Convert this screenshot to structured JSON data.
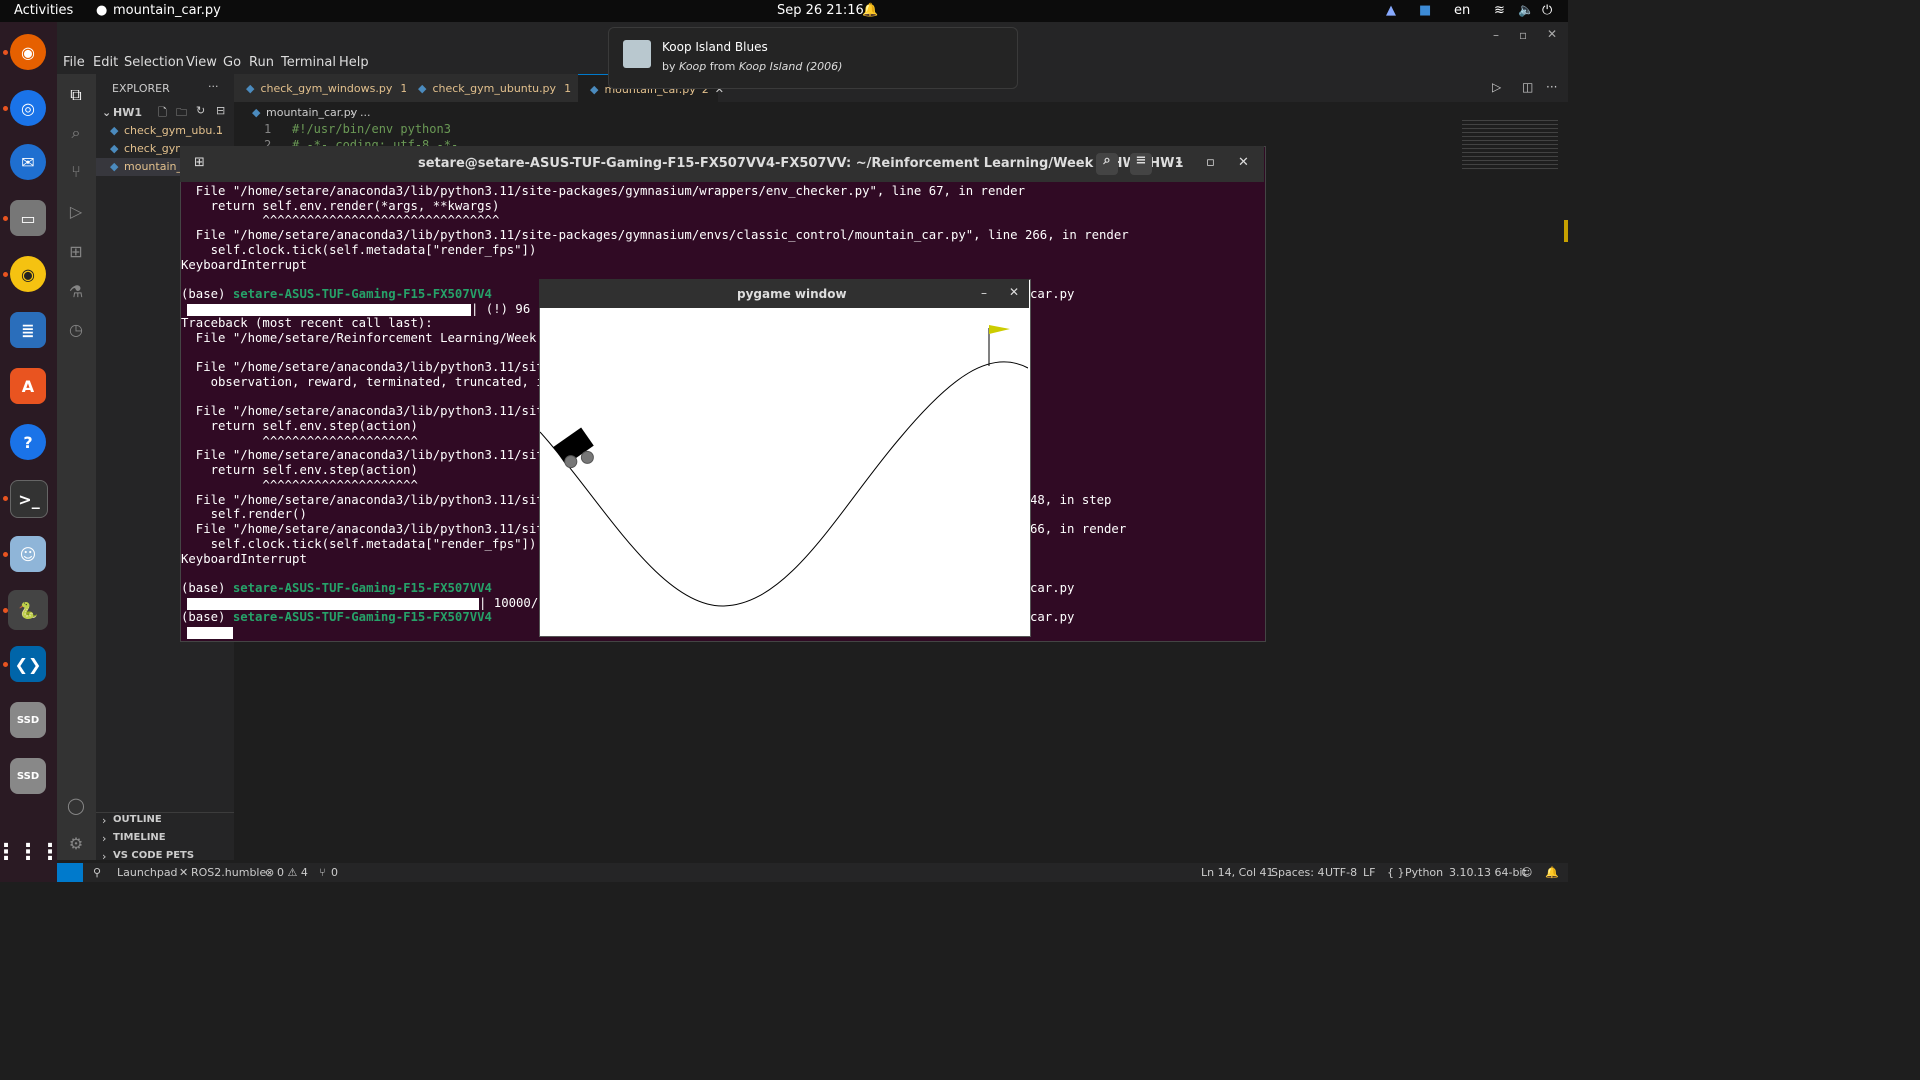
{
  "topbar": {
    "activities": "Activities",
    "app_name": "mountain_car.py",
    "clock": "Sep 26  21:16",
    "lang": "en"
  },
  "notification": {
    "title": "Koop Island Blues",
    "by": "by",
    "artist": "Koop",
    "from": "from",
    "album": "Koop Island (2006)"
  },
  "menu": [
    "File",
    "Edit",
    "Selection",
    "View",
    "Go",
    "Run",
    "Terminal",
    "Help"
  ],
  "explorer": {
    "header": "EXPLORER",
    "folder": "HW1",
    "files": [
      {
        "name": "check_gym_ubu...",
        "badge": "1"
      },
      {
        "name": "check_gym_",
        "badge": ""
      },
      {
        "name": "mountain_c",
        "badge": ""
      }
    ],
    "sections": [
      "OUTLINE",
      "TIMELINE",
      "VS CODE PETS"
    ]
  },
  "tabs": [
    {
      "label": "check_gym_windows.py",
      "badge": "1"
    },
    {
      "label": "check_gym_ubuntu.py",
      "badge": "1"
    },
    {
      "label": "mountain_car.py",
      "badge": "2"
    }
  ],
  "breadcrumb": {
    "file": "mountain_car.py",
    "rest": "..."
  },
  "editor": {
    "line1_no": "1",
    "line1": "#!/usr/bin/env python3",
    "line2_no": "2",
    "line2": "# -*- coding: utf-8 -*-"
  },
  "terminal": {
    "title": "setare@setare-ASUS-TUF-Gaming-F15-FX507VV4-FX507VV: ~/Reinforcement Learning/Week 1/HWs/HW1",
    "lines": [
      "  File \"/home/setare/anaconda3/lib/python3.11/site-packages/gymnasium/wrappers/env_checker.py\", line 67, in render",
      "    return self.env.render(*args, **kwargs)",
      "           ^^^^^^^^^^^^^^^^^^^^^^^^^^^^^^^^",
      "  File \"/home/setare/anaconda3/lib/python3.11/site-packages/gymnasium/envs/classic_control/mountain_car.py\", line 266, in render",
      "    self.clock.tick(self.metadata[\"render_fps\"])",
      "KeyboardInterrupt",
      "",
      "(base) setare-ASUS-TUF-Gaming-F15-FX507VV4",
      "| (!) 96",
      "Traceback (most recent call last):",
      "  File \"/home/setare/Reinforcement Learning/Week",
      "",
      "  File \"/home/setare/anaconda3/lib/python3.11/sit",
      "    observation, reward, terminated, truncated, i",
      "",
      "  File \"/home/setare/anaconda3/lib/python3.11/sit",
      "    return self.env.step(action)",
      "           ^^^^^^^^^^^^^^^^^^^^^",
      "  File \"/home/setare/anaconda3/lib/python3.11/sit",
      "    return self.env.step(action)",
      "           ^^^^^^^^^^^^^^^^^^^^^",
      "  File \"/home/setare/anaconda3/lib/python3.11/sit",
      "    self.render()",
      "  File \"/home/setare/anaconda3/lib/python3.11/sit",
      "    self.clock.tick(self.metadata[\"render_fps\"])",
      "KeyboardInterrupt",
      "",
      "(base) setare-ASUS-TUF-Gaming-F15-FX507VV4",
      "| 10000/",
      "(base) setare-ASUS-TUF-Gaming-F15-FX507VV4",
      "|"
    ],
    "right_fragments": [
      {
        "text": "car.py"
      },
      {
        "text": "48, in step"
      },
      {
        "text": "66, in render"
      },
      {
        "text": "car.py"
      },
      {
        "text": "car.py"
      }
    ]
  },
  "pygame": {
    "title": "pygame window"
  },
  "status": {
    "remote": "Launchpad",
    "ros": "ROS2.humble",
    "problems": "0 ⚠ 4",
    "ports": "0",
    "position": "Ln 14, Col 41",
    "spaces": "Spaces: 4",
    "encoding": "UTF-8",
    "eol": "LF",
    "language": "Python",
    "interpreter": "3.10.13 64-bit"
  },
  "colors": {
    "accent": "#e95420",
    "vscode_blue": "#007acc",
    "terminal_bg": "#300a24",
    "prompt_green": "#26a269",
    "flag": "#cccc00"
  }
}
